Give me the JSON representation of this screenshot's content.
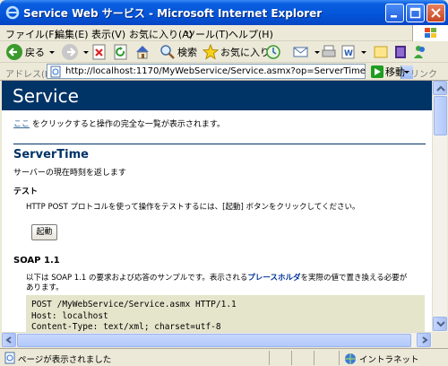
{
  "window": {
    "title": "Service Web サービス - Microsoft Internet Explorer"
  },
  "menu": {
    "items": [
      "ファイル(F)",
      "編集(E)",
      "表示(V)",
      "お気に入り(A)",
      "ツール(T)",
      "ヘルプ(H)"
    ]
  },
  "toolbar": {
    "back_label": "戻る",
    "search_label": "検索",
    "favorites_label": "お気に入り"
  },
  "address": {
    "label": "アドレス(D)",
    "url": "http://localhost:1170/MyWebService/Service.asmx?op=ServerTime",
    "go_label": "移動",
    "links_label": "リンク"
  },
  "page": {
    "service_name": "Service",
    "intro_link": "ここ",
    "intro_text": " をクリックすると操作の完全な一覧が表示されます。",
    "operation_name": "ServerTime",
    "operation_description": "サーバーの現在時刻を返します",
    "test_heading": "テスト",
    "test_instruction": "HTTP POST プロトコルを使って操作をテストするには、[起動] ボタンをクリックしてください。",
    "invoke_label": "起動",
    "soap_heading": "SOAP 1.1",
    "soap_text_before": "以下は SOAP 1.1 の要求および応答のサンプルです。表示される",
    "soap_placeholder": "プレースホルダ",
    "soap_text_after": "を実際の値で置き換える必要が",
    "soap_text_line2": "あります。",
    "code_lines": [
      "POST /MyWebService/Service.asmx HTTP/1.1",
      "Host: localhost",
      "Content-Type: text/xml; charset=utf-8"
    ]
  },
  "status": {
    "text": "ページが表示されました",
    "zone": "イントラネット"
  },
  "colors": {
    "heading_band": "#003366",
    "code_background": "#e5e5cc",
    "link": "#336699"
  }
}
